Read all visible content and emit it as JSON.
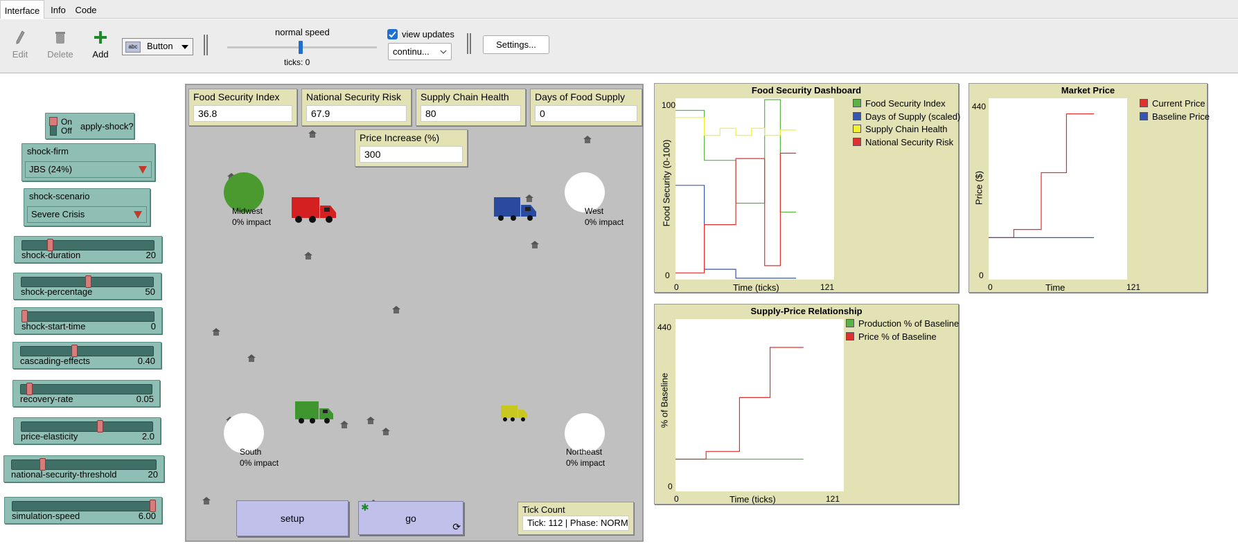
{
  "tabs": [
    "Interface",
    "Info",
    "Code"
  ],
  "toolbar": {
    "edit": "Edit",
    "delete": "Delete",
    "add": "Add",
    "widget_type": "Button",
    "speed_label": "normal speed",
    "ticks_label": "ticks: 0",
    "view_updates": "view updates",
    "update_mode": "continu...",
    "settings": "Settings..."
  },
  "switch": {
    "on": "On",
    "off": "Off",
    "name": "apply-shock?"
  },
  "choosers": [
    {
      "name": "shock-firm",
      "value": "JBS (24%)"
    },
    {
      "name": "shock-scenario",
      "value": "Severe Crisis"
    }
  ],
  "sliders": [
    {
      "name": "shock-duration",
      "value": "20",
      "fraction": 0.2
    },
    {
      "name": "shock-percentage",
      "value": "50",
      "fraction": 0.5
    },
    {
      "name": "shock-start-time",
      "value": "0",
      "fraction": 0.0
    },
    {
      "name": "cascading-effects",
      "value": "0.40",
      "fraction": 0.4
    },
    {
      "name": "recovery-rate",
      "value": "0.05",
      "fraction": 0.05
    },
    {
      "name": "price-elasticity",
      "value": "2.0",
      "fraction": 0.6
    },
    {
      "name": "national-security-threshold",
      "value": "20",
      "fraction": 0.2
    },
    {
      "name": "simulation-speed",
      "value": "6.00",
      "fraction": 1.0
    }
  ],
  "monitors": [
    {
      "label": "Food Security Index",
      "value": "36.8"
    },
    {
      "label": "National Security Risk",
      "value": "67.9"
    },
    {
      "label": "Supply Chain Health",
      "value": "80"
    },
    {
      "label": "Days of Food Supply",
      "value": "0"
    },
    {
      "label": "Price Increase (%)",
      "value": "300"
    }
  ],
  "regions": [
    {
      "name": "Midwest",
      "impact": "0% impact",
      "color": "#4b9a2f"
    },
    {
      "name": "West",
      "impact": "0% impact",
      "color": "#ffffff"
    },
    {
      "name": "South",
      "impact": "0% impact",
      "color": "#ffffff"
    },
    {
      "name": "Northeast",
      "impact": "0% impact",
      "color": "#ffffff"
    }
  ],
  "buttons": {
    "setup": "setup",
    "go": "go"
  },
  "tick_monitor": {
    "label": "Tick Count",
    "value": "Tick: 112 | Phase: NORMAL"
  },
  "colors": {
    "green": "#59b347",
    "blue": "#3456b0",
    "yellow": "#f1f12d",
    "red": "#e03030"
  },
  "plots": [
    {
      "title": "Food Security Dashboard",
      "ylabel": "Food Security (0-100)",
      "xlabel": "Time (ticks)",
      "xmin": "0",
      "xmax": "121",
      "ymin": "0",
      "ymax": "100",
      "legend": [
        {
          "name": "Food Security Index",
          "color": "#59b347"
        },
        {
          "name": "Days of Supply (scaled)",
          "color": "#3456b0"
        },
        {
          "name": "Supply Chain Health",
          "color": "#f1f12d"
        },
        {
          "name": "National Security Risk",
          "color": "#e03030"
        }
      ]
    },
    {
      "title": "Market Price",
      "ylabel": "Price ($)",
      "xlabel": "Time",
      "xmin": "0",
      "xmax": "121",
      "ymin": "0",
      "ymax": "440",
      "legend": [
        {
          "name": "Current Price",
          "color": "#e03030"
        },
        {
          "name": "Baseline Price",
          "color": "#3456b0"
        }
      ]
    },
    {
      "title": "Supply-Price Relationship",
      "ylabel": "% of Baseline",
      "xlabel": "Time (ticks)",
      "xmin": "0",
      "xmax": "121",
      "ymin": "0",
      "ymax": "440",
      "legend": [
        {
          "name": "Production % of Baseline",
          "color": "#59b347"
        },
        {
          "name": "Price % of Baseline",
          "color": "#e03030"
        }
      ]
    }
  ],
  "chart_data": [
    {
      "type": "line",
      "title": "Food Security Dashboard",
      "xlabel": "Time (ticks)",
      "ylabel": "Food Security (0-100)",
      "xlim": [
        0,
        121
      ],
      "ylim": [
        0,
        100
      ],
      "series": [
        {
          "name": "Food Security Index",
          "points": [
            [
              0,
              94
            ],
            [
              22,
              94
            ],
            [
              22,
              66
            ],
            [
              46,
              66
            ],
            [
              46,
              66
            ],
            [
              46,
              42
            ],
            [
              68,
              42
            ],
            [
              68,
              100
            ],
            [
              80,
              100
            ],
            [
              80,
              37
            ],
            [
              92,
              37
            ]
          ]
        },
        {
          "name": "Days of Supply (scaled)",
          "points": [
            [
              0,
              52
            ],
            [
              22,
              52
            ],
            [
              22,
              5
            ],
            [
              46,
              5
            ],
            [
              46,
              0
            ],
            [
              92,
              0
            ]
          ]
        },
        {
          "name": "Supply Chain Health",
          "points": [
            [
              0,
              90
            ],
            [
              22,
              90
            ],
            [
              22,
              80
            ],
            [
              34,
              80
            ],
            [
              34,
              84
            ],
            [
              46,
              84
            ],
            [
              46,
              80
            ],
            [
              58,
              80
            ],
            [
              58,
              84
            ],
            [
              68,
              84
            ],
            [
              68,
              80
            ],
            [
              80,
              80
            ],
            [
              80,
              83
            ],
            [
              92,
              83
            ]
          ]
        },
        {
          "name": "National Security Risk",
          "points": [
            [
              0,
              3
            ],
            [
              22,
              3
            ],
            [
              22,
              30
            ],
            [
              46,
              30
            ],
            [
              46,
              67
            ],
            [
              68,
              67
            ],
            [
              68,
              7
            ],
            [
              80,
              7
            ],
            [
              80,
              70
            ],
            [
              92,
              70
            ]
          ]
        }
      ]
    },
    {
      "type": "line",
      "title": "Market Price",
      "xlabel": "Time",
      "ylabel": "Price ($)",
      "xlim": [
        0,
        121
      ],
      "ylim": [
        0,
        440
      ],
      "series": [
        {
          "name": "Current Price",
          "points": [
            [
              0,
              100
            ],
            [
              22,
              100
            ],
            [
              22,
              120
            ],
            [
              46,
              120
            ],
            [
              46,
              260
            ],
            [
              68,
              260
            ],
            [
              68,
              405
            ],
            [
              92,
              405
            ]
          ]
        },
        {
          "name": "Baseline Price",
          "points": [
            [
              0,
              100
            ],
            [
              92,
              100
            ]
          ]
        }
      ]
    },
    {
      "type": "line",
      "title": "Supply-Price Relationship",
      "xlabel": "Time (ticks)",
      "ylabel": "% of Baseline",
      "xlim": [
        0,
        121
      ],
      "ylim": [
        0,
        440
      ],
      "series": [
        {
          "name": "Production % of Baseline",
          "points": [
            [
              0,
              80
            ],
            [
              92,
              80
            ]
          ]
        },
        {
          "name": "Price % of Baseline",
          "points": [
            [
              0,
              80
            ],
            [
              22,
              80
            ],
            [
              22,
              100
            ],
            [
              46,
              100
            ],
            [
              46,
              240
            ],
            [
              68,
              240
            ],
            [
              68,
              370
            ],
            [
              92,
              370
            ]
          ]
        }
      ]
    }
  ]
}
